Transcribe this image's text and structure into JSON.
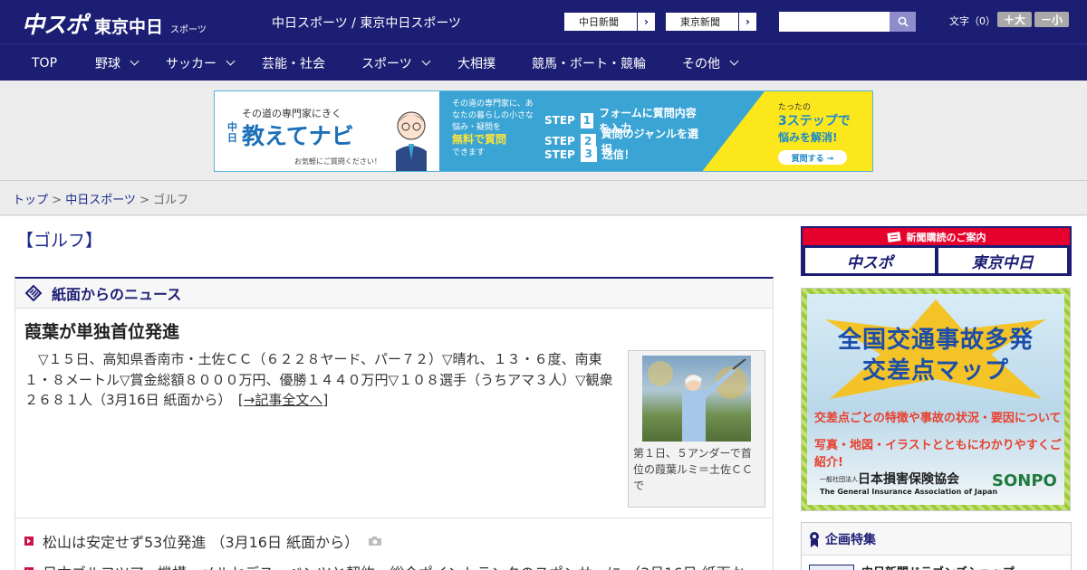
{
  "header": {
    "logo_main": "中スポ",
    "logo_sub": "東京中日",
    "logo_sub_small": "スポーツ",
    "site_names": "中日スポーツ / 東京中日スポーツ",
    "links": [
      {
        "label": "中日新聞"
      },
      {
        "label": "東京新聞"
      }
    ],
    "search_placeholder": "",
    "font_size_label": "文字（0）",
    "font_larger": "＋大",
    "font_smaller": "－小"
  },
  "nav": {
    "items": [
      {
        "label": "TOP",
        "dropdown": false
      },
      {
        "label": "野球",
        "dropdown": true
      },
      {
        "label": "サッカー",
        "dropdown": true
      },
      {
        "label": "芸能・社会",
        "dropdown": false
      },
      {
        "label": "スポーツ",
        "dropdown": true
      },
      {
        "label": "大相撲",
        "dropdown": false
      },
      {
        "label": "競馬・ボート・競輪",
        "dropdown": false
      },
      {
        "label": "その他",
        "dropdown": true
      }
    ]
  },
  "banner": {
    "kicker": "その道の専門家にきく",
    "mark": "中日",
    "title": "教えてナビ",
    "note": "お気軽にご質問ください！",
    "desc_1": "その道の専門家に、あなたの暮らしの小さな悩み・疑問を",
    "desc_hl": "無料で質問",
    "desc_2": "できます",
    "steps": [
      {
        "step": "STEP",
        "num": "1",
        "text": "フォームに質問内容を入力"
      },
      {
        "step": "STEP",
        "num": "2",
        "text": "質問のジャンルを選択"
      },
      {
        "step": "STEP",
        "num": "3",
        "text": "送信！"
      }
    ],
    "right_1": "たったの",
    "right_2": "3ステップで",
    "right_3": "悩みを解消!",
    "right_btn": "質問する →"
  },
  "breadcrumb": {
    "home": "トップ",
    "sep1": " > ",
    "section": "中日スポーツ",
    "sep2": " > ",
    "current": "ゴルフ"
  },
  "page": {
    "title": "【ゴルフ】"
  },
  "news": {
    "heading": "紙面からのニュース",
    "article": {
      "title": "葭葉が単独首位発進",
      "body": "　▽１５日、高知県香南市・土佐ＣＣ（６２２８ヤード、パー７２）▽晴れ、１３・６度、南東１・８メートル▽賞金総額８０００万円、優勝１４４０万円▽１０８選手（うちアマ３人）▽観衆２６８１人（3月16日 紙面から）",
      "more": "[→記事全文へ]",
      "photo_caption": "第１日、５アンダーで首位の葭葉ルミ＝土佐ＣＣで"
    },
    "items": [
      {
        "text": "松山は安定せず53位発進 （3月16日 紙面から）"
      },
      {
        "text": "日本ゴルフツアー機構、メルセデス・ベンツと契約　総合ポイントランクのスポンサーに （3月16日 紙面か"
      }
    ]
  },
  "sidebar": {
    "subscribe_title": "新聞購読のご案内",
    "subscribe_logos": [
      "中スポ",
      "東京中日"
    ],
    "ad_title_1": "全国交通事故多発",
    "ad_title_2": "交差点マップ",
    "ad_line_1": "交差点ごとの特徴や事故の状況・要因について",
    "ad_line_2": "写真・地図・イラストとともにわかりやすくご紹介!",
    "ad_org_small": "一般社団法人",
    "ad_org": "日本損害保険協会",
    "ad_org_en": "The General Insurance Association of Japan",
    "ad_brand": "SONPO",
    "feature_title": "企画特集",
    "feature_item": "中日新聞ドラゴンズショップ"
  },
  "colors": {
    "brand_navy": "#1c1e74",
    "accent_red": "#cc1144",
    "link_blue": "#1c2a8c"
  }
}
